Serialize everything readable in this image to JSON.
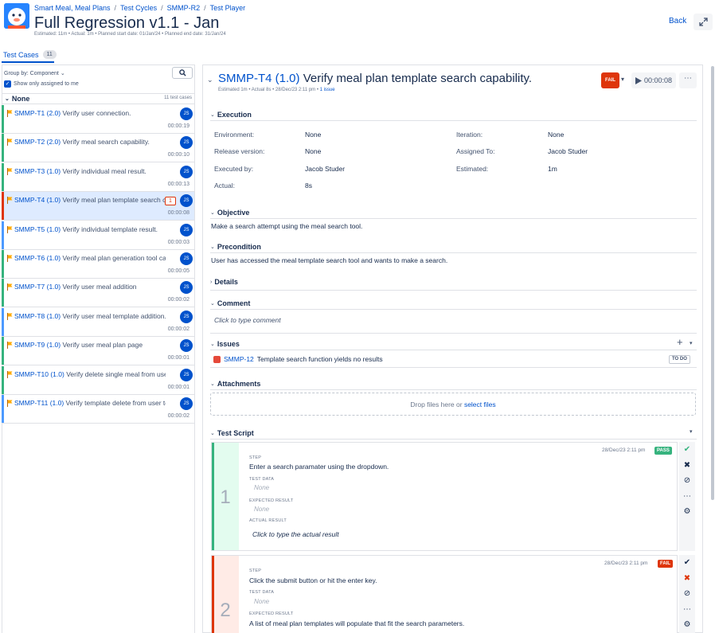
{
  "header": {
    "breadcrumbs": [
      "Smart Meal, Meal Plans",
      "Test Cycles",
      "SMMP-R2",
      "Test Player"
    ],
    "title": "Full Regression v1.1 - Jan",
    "meta": "Estimated: 11m  •  Actual: 1m  •  Planned start date: 01/Jan/24  •  Planned end date: 31/Jan/24",
    "back_label": "Back"
  },
  "tabs": {
    "label": "Test Cases",
    "count": "11"
  },
  "left": {
    "group_by": "Group by: Component",
    "only_me": "Show only assigned to me",
    "group_name": "None",
    "group_count": "11 test cases",
    "items": [
      {
        "key": "SMMP-T1 (2.0)",
        "name": " Verify user connection.",
        "time": "00:00:19",
        "avatar": "JS",
        "status_color": "#36b37e"
      },
      {
        "key": "SMMP-T2 (2.0)",
        "name": " Verify meal search capability.",
        "time": "00:00:10",
        "avatar": "JS",
        "status_color": "#36b37e"
      },
      {
        "key": "SMMP-T3 (1.0)",
        "name": " Verify individual meal result.",
        "time": "00:00:13",
        "avatar": "JS",
        "status_color": "#36b37e"
      },
      {
        "key": "SMMP-T4 (1.0)",
        "name": " Verify meal plan template search capability.",
        "time": "00:00:08",
        "avatar": "JS",
        "status_color": "#de350b",
        "badge": "1"
      },
      {
        "key": "SMMP-T5 (1.0)",
        "name": " Verify individual template result.",
        "time": "00:00:03",
        "avatar": "JS",
        "status_color": "#4c9aff"
      },
      {
        "key": "SMMP-T6 (1.0)",
        "name": " Verify meal plan generation tool capability.",
        "time": "00:00:05",
        "avatar": "JS",
        "status_color": "#36b37e"
      },
      {
        "key": "SMMP-T7 (1.0)",
        "name": " Verify user meal addition",
        "time": "00:00:02",
        "avatar": "JS",
        "status_color": "#36b37e"
      },
      {
        "key": "SMMP-T8 (1.0)",
        "name": " Verify user meal template addition.",
        "time": "00:00:02",
        "avatar": "JS",
        "status_color": "#4c9aff"
      },
      {
        "key": "SMMP-T9 (1.0)",
        "name": " Verify user meal plan page",
        "time": "00:00:01",
        "avatar": "JS",
        "status_color": "#36b37e"
      },
      {
        "key": "SMMP-T10 (1.0)",
        "name": " Verify delete single meal from user meals.",
        "time": "00:00:01",
        "avatar": "JS",
        "status_color": "#36b37e"
      },
      {
        "key": "SMMP-T11 (1.0)",
        "name": " Verify template delete from user templates.",
        "time": "00:00:02",
        "avatar": "JS",
        "status_color": "#4c9aff"
      }
    ]
  },
  "detail": {
    "key": "SMMP-T4 (1.0)",
    "name": "Verify meal plan template search capability.",
    "meta_prefix": "Estimated 1m  •  Actual 8s  •  28/Dec/23 2:11 pm  •  ",
    "meta_issue": "1 issue",
    "status": "FAIL",
    "timer": "00:00:08",
    "execution": {
      "title": "Execution",
      "env_label": "Environment:",
      "env_value": "None",
      "iter_label": "Iteration:",
      "iter_value": "None",
      "rel_label": "Release version:",
      "rel_value": "None",
      "assigned_label": "Assigned To:",
      "assigned_value": "Jacob Studer",
      "exec_label": "Executed by:",
      "exec_value": "Jacob Studer",
      "est_label": "Estimated:",
      "est_value": "1m",
      "actual_label": "Actual:",
      "actual_value": "8s"
    },
    "objective": {
      "title": "Objective",
      "text": "Make a search attempt using the meal search tool."
    },
    "precondition": {
      "title": "Precondition",
      "text": "User has accessed the meal template search tool and wants to make a search."
    },
    "details_title": "Details",
    "comment": {
      "title": "Comment",
      "placeholder": "Click to type comment"
    },
    "issues": {
      "title": "Issues",
      "key": "SMMP-12",
      "text": " Template search function yields no results",
      "status": "TO DO"
    },
    "attachments": {
      "title": "Attachments",
      "drop": "Drop files here or ",
      "select": "select files"
    },
    "script": {
      "title": "Test Script",
      "steps": [
        {
          "num": "1",
          "date": "28/Dec/23 2:11 pm",
          "result": "PASS",
          "result_color": "#36b37e",
          "side_color": "#e3fcef",
          "bar_color": "#36b37e",
          "step_cap": "STEP",
          "step": "Enter a search paramater using the dropdown.",
          "data_cap": "TEST DATA",
          "data": "None",
          "exp_cap": "EXPECTED RESULT",
          "exp": "None",
          "act_cap": "ACTUAL RESULT",
          "act": "Click to type the actual result"
        },
        {
          "num": "2",
          "date": "28/Dec/23 2:11 pm",
          "result": "FAIL",
          "result_color": "#de350b",
          "side_color": "#ffebe6",
          "bar_color": "#de350b",
          "step_cap": "STEP",
          "step": "Click the submit button or hit the enter key.",
          "data_cap": "TEST DATA",
          "data": "None",
          "exp_cap": "EXPECTED RESULT",
          "exp": "A list of meal plan templates will populate that fit the search parameters."
        }
      ]
    }
  }
}
